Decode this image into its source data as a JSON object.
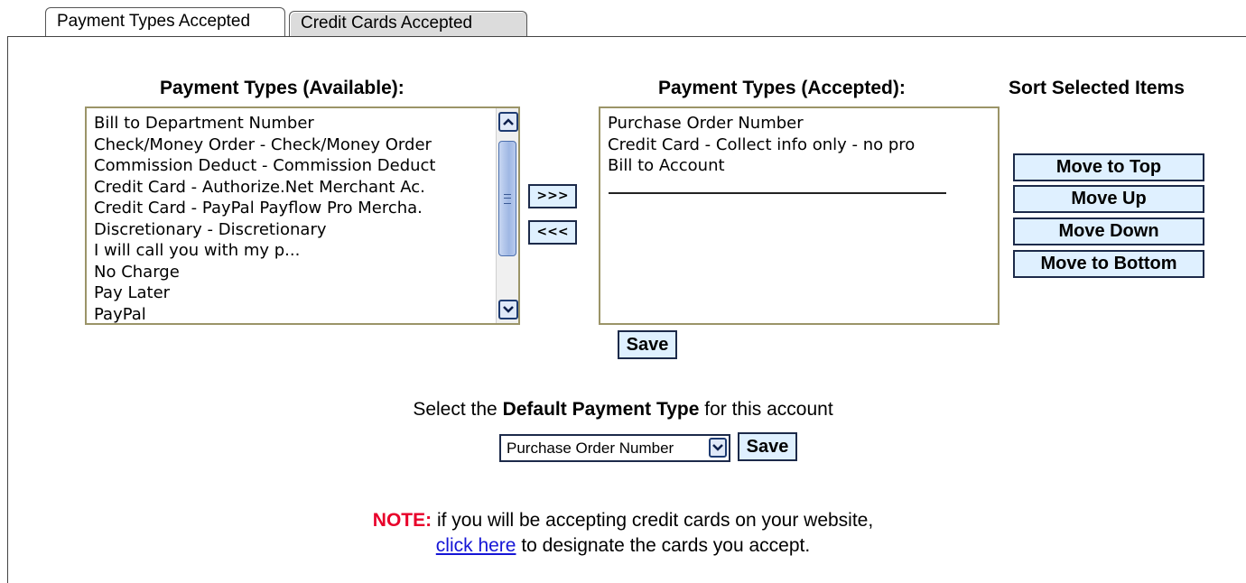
{
  "tabs": [
    {
      "label": "Payment Types Accepted",
      "active": true
    },
    {
      "label": "Credit Cards Accepted",
      "active": false
    }
  ],
  "available": {
    "heading": "Payment Types (Available):",
    "items": [
      "Bill to Department Number",
      "Check/Money Order - Check/Money Order",
      "Commission Deduct - Commission Deduct",
      "Credit Card - Authorize.Net Merchant Ac.",
      "Credit Card - PayPal Payflow Pro Mercha.",
      "Discretionary - Discretionary",
      "I will call you with my p...",
      "No Charge",
      "Pay Later",
      "PayPal"
    ]
  },
  "transfer": {
    "add_label": ">>>",
    "remove_label": "<<<"
  },
  "accepted": {
    "heading": "Payment Types (Accepted):",
    "items": [
      "Purchase Order Number",
      "Credit Card - Collect info only - no pro",
      "Bill to Account"
    ],
    "save_label": "Save"
  },
  "sort": {
    "heading": "Sort Selected Items",
    "buttons": [
      "Move to Top",
      "Move Up",
      "Move Down",
      "Move to Bottom"
    ]
  },
  "default_payment": {
    "prefix": "Select the ",
    "bold": "Default Payment Type",
    "suffix": " for this account",
    "selected": "Purchase Order Number",
    "save_label": "Save"
  },
  "note": {
    "label": "NOTE:",
    "text": " if you will be accepting credit cards on your website,",
    "link": "click here",
    "after_link": " to designate the cards you accept."
  },
  "colors": {
    "note": "#e8002a",
    "link": "#1515d6",
    "button_bg": "#dff0ff",
    "listbox_border": "#9b9468"
  }
}
